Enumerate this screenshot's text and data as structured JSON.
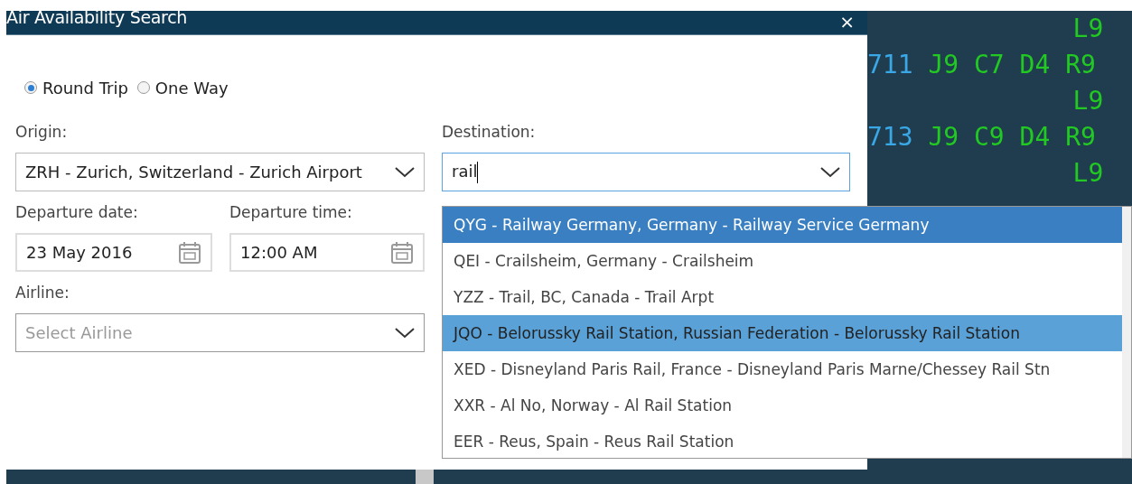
{
  "window": {
    "title": "Air Availability Search",
    "close": "×"
  },
  "trip_type": [
    {
      "label": "Round Trip",
      "selected": true
    },
    {
      "label": "One Way",
      "selected": false
    }
  ],
  "origin": {
    "label": "Origin:",
    "value": "ZRH - Zurich, Switzerland - Zurich Airport"
  },
  "destination": {
    "label": "Destination:",
    "value": "rail",
    "options": [
      {
        "label": "QYG - Railway Germany, Germany - Railway Service Germany",
        "selected": true,
        "highlighted": false
      },
      {
        "label": "QEI - Crailsheim, Germany - Crailsheim",
        "selected": false,
        "highlighted": false
      },
      {
        "label": "YZZ - Trail, BC, Canada - Trail Arpt",
        "selected": false,
        "highlighted": false
      },
      {
        "label": "JQO - Belorussky Rail Station, Russian Federation - Belorussky Rail Station",
        "selected": false,
        "highlighted": true
      },
      {
        "label": "XED - Disneyland Paris Rail, France - Disneyland Paris Marne/Chessey Rail Stn",
        "selected": false,
        "highlighted": false
      },
      {
        "label": "XXR - Al No, Norway - Al Rail Station",
        "selected": false,
        "highlighted": false
      },
      {
        "label": "EER - Reus, Spain - Reus Rail Station",
        "selected": false,
        "highlighted": false
      }
    ]
  },
  "departure_date": {
    "label": "Departure date:",
    "value": "23 May 2016"
  },
  "departure_time": {
    "label": "Departure time:",
    "value": "12:00 AM"
  },
  "airline": {
    "label": "Airline:",
    "placeholder": "Select Airline"
  },
  "terminal": {
    "lines": [
      {
        "kind": "continuation",
        "classes": "L9"
      },
      {
        "kind": "flight",
        "flight": "711",
        "classes": "J9 C7 D4 R9"
      },
      {
        "kind": "continuation",
        "classes": "L9"
      },
      {
        "kind": "flight",
        "flight": "713",
        "classes": "J9 C9 D4 R9"
      },
      {
        "kind": "continuation",
        "classes": "L9"
      }
    ]
  }
}
